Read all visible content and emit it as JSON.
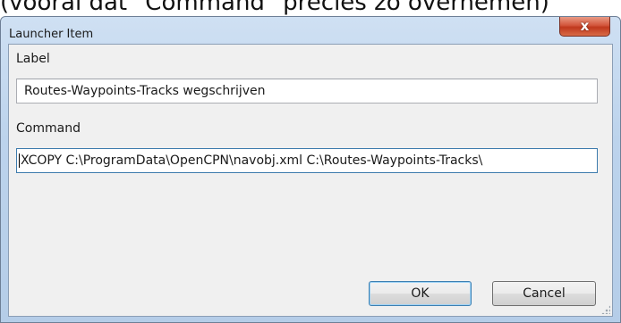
{
  "background_text": "(vooral dat \"Command\" precies zo overnemen)",
  "window": {
    "title": "Launcher Item",
    "close_label": "x"
  },
  "form": {
    "label_caption": "Label",
    "label_value": "Routes-Waypoints-Tracks wegschrijven",
    "command_caption": "Command",
    "command_value": "XCOPY C:\\ProgramData\\OpenCPN\\navobj.xml C:\\Routes-Waypoints-Tracks\\"
  },
  "buttons": {
    "ok_label": "OK",
    "cancel_label": "Cancel"
  },
  "colors": {
    "frame": "#bcd3ec",
    "close": "#c0381d",
    "client": "#f0f0f0",
    "focus_border": "#3d7bad"
  }
}
